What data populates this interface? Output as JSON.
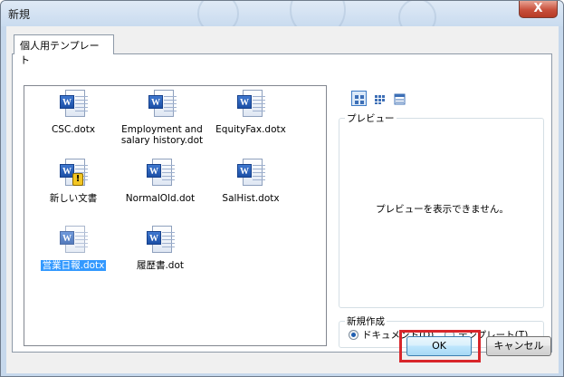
{
  "window": {
    "title": "新規",
    "close_label": "X"
  },
  "tab": {
    "label": "個人用テンプレート"
  },
  "templates": [
    {
      "label": "CSC.dotx",
      "icon": "word-template-icon"
    },
    {
      "label": "Employment and salary history.dot",
      "icon": "word-template-icon"
    },
    {
      "label": "EquityFax.dotx",
      "icon": "word-template-icon"
    },
    {
      "label": "新しい文書",
      "icon": "word-template-warning-icon"
    },
    {
      "label": "NormalOld.dot",
      "icon": "word-template-icon"
    },
    {
      "label": "SalHist.dotx",
      "icon": "word-template-icon"
    },
    {
      "label": "営業日報.dotx",
      "icon": "word-template-icon",
      "selected": true
    },
    {
      "label": "履歴書.dot",
      "icon": "word-template-icon"
    }
  ],
  "view_buttons": [
    {
      "name": "large-icons",
      "active": true
    },
    {
      "name": "list",
      "active": false
    },
    {
      "name": "details",
      "active": false
    }
  ],
  "preview": {
    "legend": "プレビュー",
    "message": "プレビューを表示できません。"
  },
  "create_new": {
    "legend": "新規作成",
    "options": [
      {
        "label_main": "ドキュメント(",
        "accel": "D",
        "label_end": ")",
        "checked": true
      },
      {
        "label_main": "テンプレート(",
        "accel": "T",
        "label_end": ")",
        "checked": false
      }
    ]
  },
  "buttons": {
    "ok": "OK",
    "cancel": "キャンセル"
  },
  "colors": {
    "selection": "#3399ff",
    "highlight": "#d8262b",
    "title_gradient_top": "#dfeaf6"
  }
}
